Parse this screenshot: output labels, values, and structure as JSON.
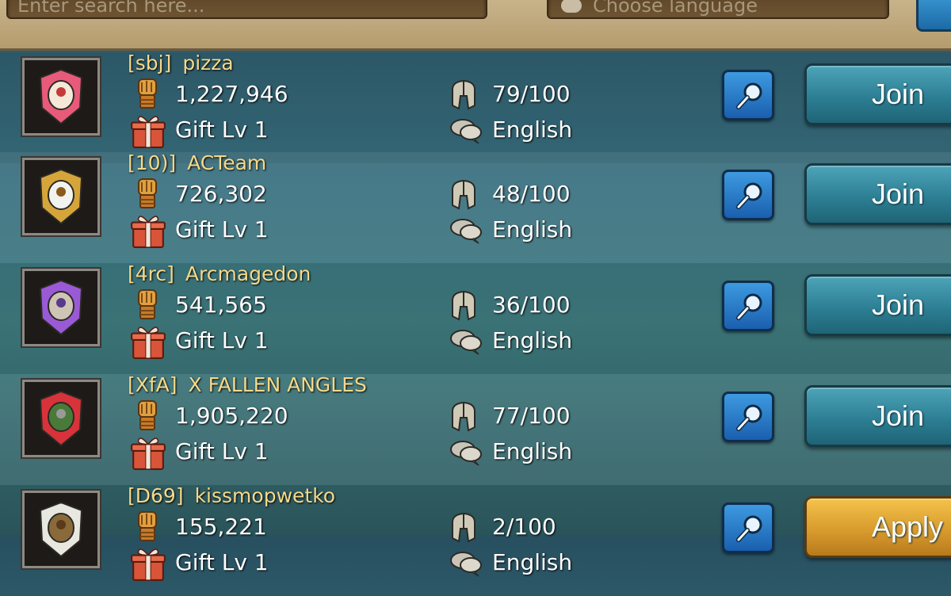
{
  "search": {
    "placeholder": "Enter search here..."
  },
  "language": {
    "placeholder": "Choose language"
  },
  "guilds": [
    {
      "tag": "[sbj]",
      "name": "pizza",
      "power": "1,227,946",
      "members": "79/100",
      "gift": "Gift Lv 1",
      "lang": "English",
      "button": "Join"
    },
    {
      "tag": "[10)]",
      "name": "ACTeam",
      "power": "726,302",
      "members": "48/100",
      "gift": "Gift Lv 1",
      "lang": "English",
      "button": "Join"
    },
    {
      "tag": "[4rc]",
      "name": "Arcmagedon",
      "power": "541,565",
      "members": "36/100",
      "gift": "Gift Lv 1",
      "lang": "English",
      "button": "Join"
    },
    {
      "tag": "[XfA]",
      "name": "X FALLEN  ANGLES",
      "power": "1,905,220",
      "members": "77/100",
      "gift": "Gift Lv 1",
      "lang": "English",
      "button": "Join"
    },
    {
      "tag": "[D69]",
      "name": "kissmopwetko",
      "power": "155,221",
      "members": "2/100",
      "gift": "Gift Lv 1",
      "lang": "English",
      "button": "Apply"
    }
  ],
  "icons": {
    "power": "fist-icon",
    "members": "helmet-icon",
    "gift": "gift-icon",
    "language": "speech-bubble-icon",
    "view": "magnifier-icon"
  }
}
